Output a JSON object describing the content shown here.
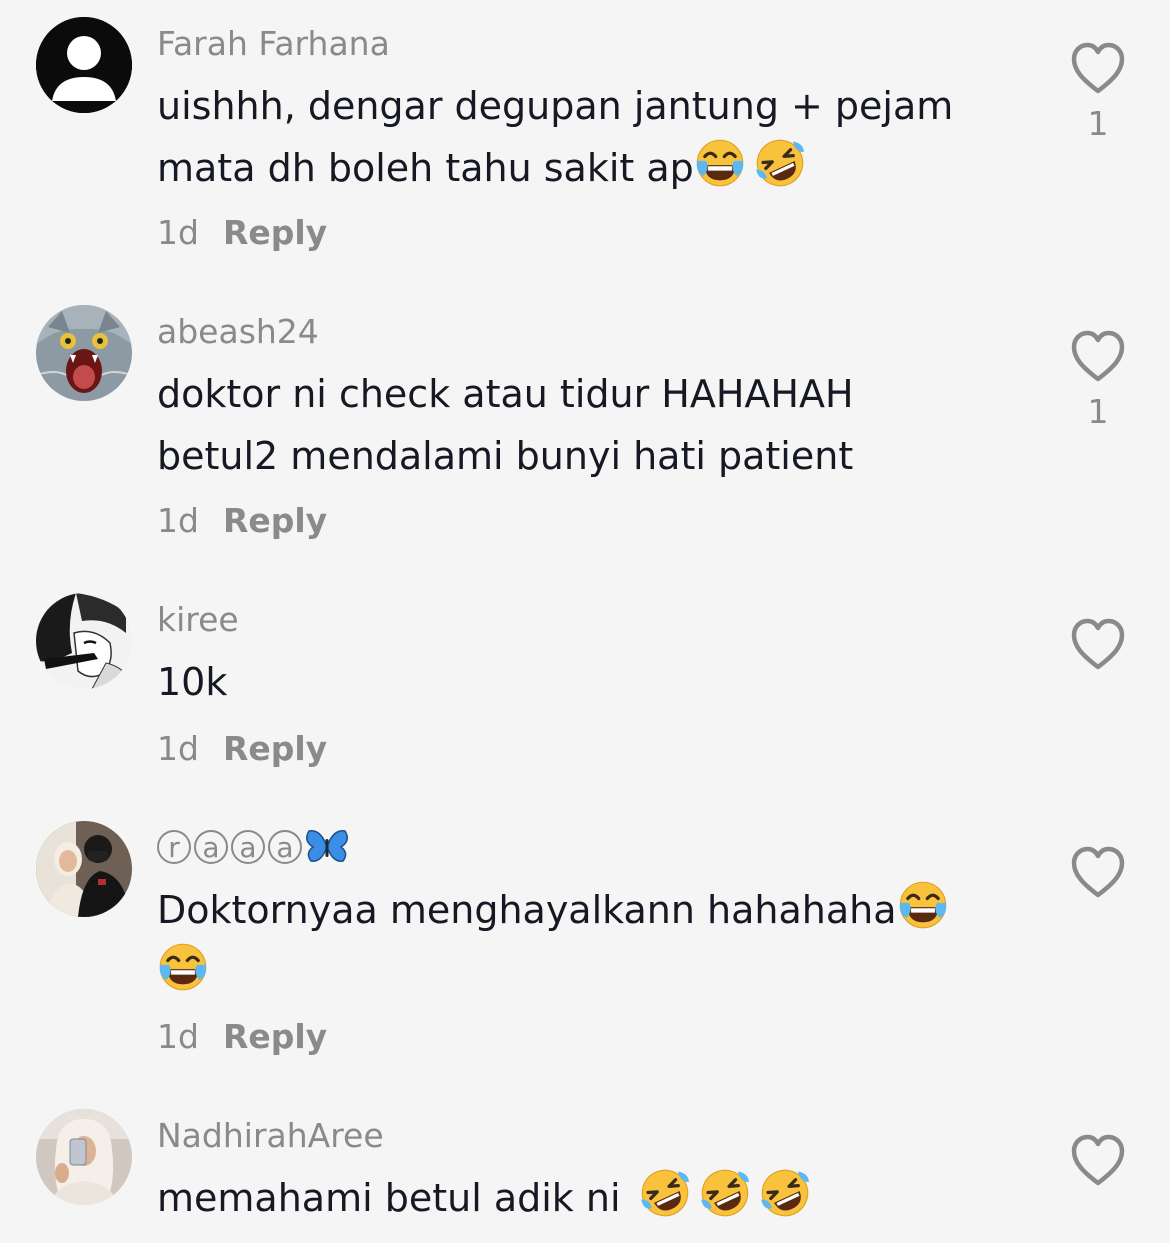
{
  "comments": [
    {
      "username": "Farah Farhana",
      "text_line1": "uishhh, dengar degupan jantung + pejam",
      "text_line2": "mata dh boleh tahu sakit ap",
      "emojis": [
        "face-with-tears-of-joy-emoji",
        "rolling-on-floor-laughing-emoji"
      ],
      "time": "1d",
      "reply_label": "Reply",
      "likes": "1",
      "avatar": "default-user-avatar"
    },
    {
      "username": "abeash24",
      "text_line1": "doktor ni check atau tidur HAHAHAH",
      "text_line2": "betul2 mendalami bunyi hati patient",
      "time": "1d",
      "reply_label": "Reply",
      "likes": "1",
      "avatar": "screaming-cat-avatar"
    },
    {
      "username": "kiree",
      "text_line1": "10k",
      "time": "1d",
      "reply_label": "Reply",
      "likes": "",
      "avatar": "manga-portrait-avatar"
    },
    {
      "username_letters": [
        "r",
        "a",
        "a",
        "a"
      ],
      "username_emoji": "butterfly-emoji",
      "text_line1": "Doktornyaa menghayalkann hahahaha",
      "text_line2_emoji": "face-with-tears-of-joy-emoji",
      "time": "1d",
      "reply_label": "Reply",
      "likes": "",
      "avatar": "couple-photo-avatar"
    },
    {
      "username": "NadhirahAree",
      "text_line1": "memahami betul adik ni",
      "emojis": [
        "rolling-on-floor-laughing-emoji",
        "rolling-on-floor-laughing-emoji",
        "rolling-on-floor-laughing-emoji"
      ],
      "avatar": "selfie-photo-avatar"
    }
  ],
  "colors": {
    "background": "#f5f5f5",
    "text": "#161823",
    "secondary": "#8a8a8a"
  }
}
